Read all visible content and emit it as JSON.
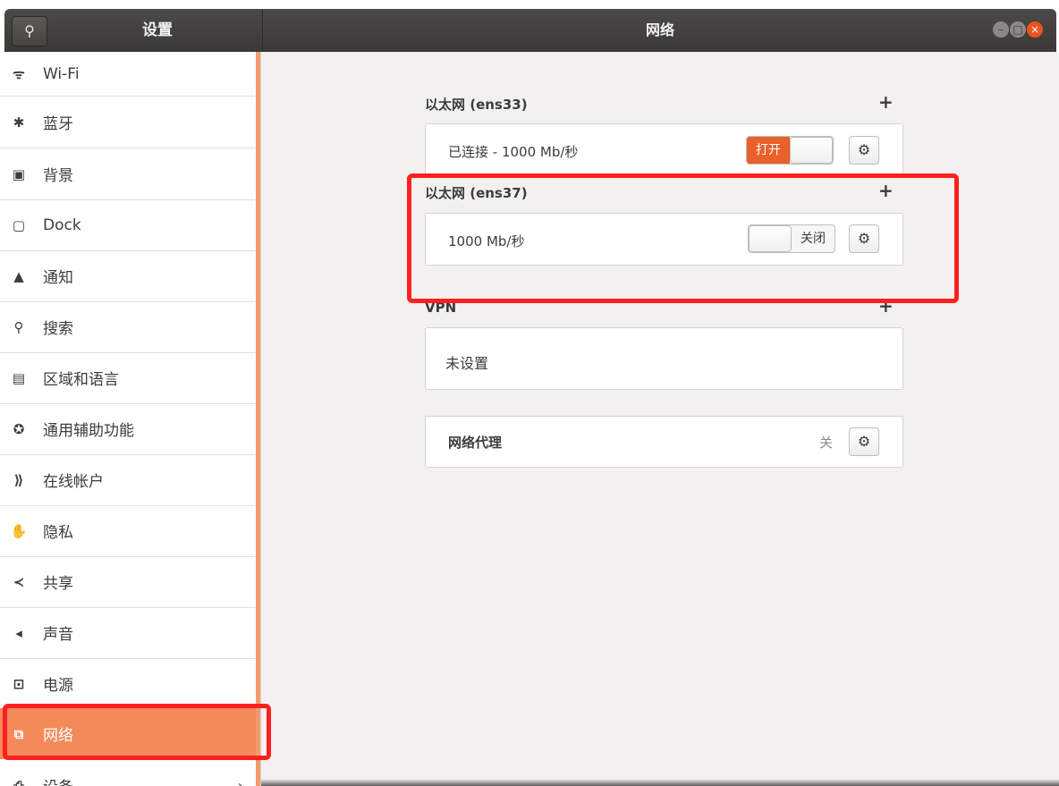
{
  "window": {
    "sidebar_title": "设置",
    "main_title": "网络",
    "search_icon": "search-icon",
    "controls": {
      "minimize": "–",
      "maximize": "□",
      "close": "×"
    }
  },
  "sidebar": {
    "items": [
      {
        "label": "Wi-Fi",
        "icon": "ᯤ"
      },
      {
        "label": "蓝牙",
        "icon": "✱"
      },
      {
        "label": "背景",
        "icon": "▣"
      },
      {
        "label": "Dock",
        "icon": "▢"
      },
      {
        "label": "通知",
        "icon": "▲"
      },
      {
        "label": "搜索",
        "icon": "⚲"
      },
      {
        "label": "区域和语言",
        "icon": "▤"
      },
      {
        "label": "通用辅助功能",
        "icon": "✪"
      },
      {
        "label": "在线帐户",
        "icon": "⟫"
      },
      {
        "label": "隐私",
        "icon": "✋"
      },
      {
        "label": "共享",
        "icon": "≺"
      },
      {
        "label": "声音",
        "icon": "◂"
      },
      {
        "label": "电源",
        "icon": "⊡"
      },
      {
        "label": "网络",
        "icon": "⧉"
      },
      {
        "label": "设备",
        "icon": "⎙"
      }
    ],
    "selected_index": 13,
    "chevron": "›"
  },
  "main": {
    "wired1": {
      "title": "以太网 (ens33)",
      "add": "+",
      "status": "已连接 - 1000 Mb/秒",
      "toggle_label": "打开",
      "toggle_on": true
    },
    "wired2": {
      "title": "以太网 (ens37)",
      "add": "+",
      "status": "1000 Mb/秒",
      "toggle_label": "关闭",
      "toggle_on": false
    },
    "vpn": {
      "title": "VPN",
      "add": "+",
      "status": "未设置"
    },
    "proxy": {
      "title": "网络代理",
      "value": "关"
    },
    "gear": "⚙"
  },
  "colors": {
    "accent": "#e95420",
    "selected_bg": "#f4895a",
    "highlight": "#ff2020"
  }
}
